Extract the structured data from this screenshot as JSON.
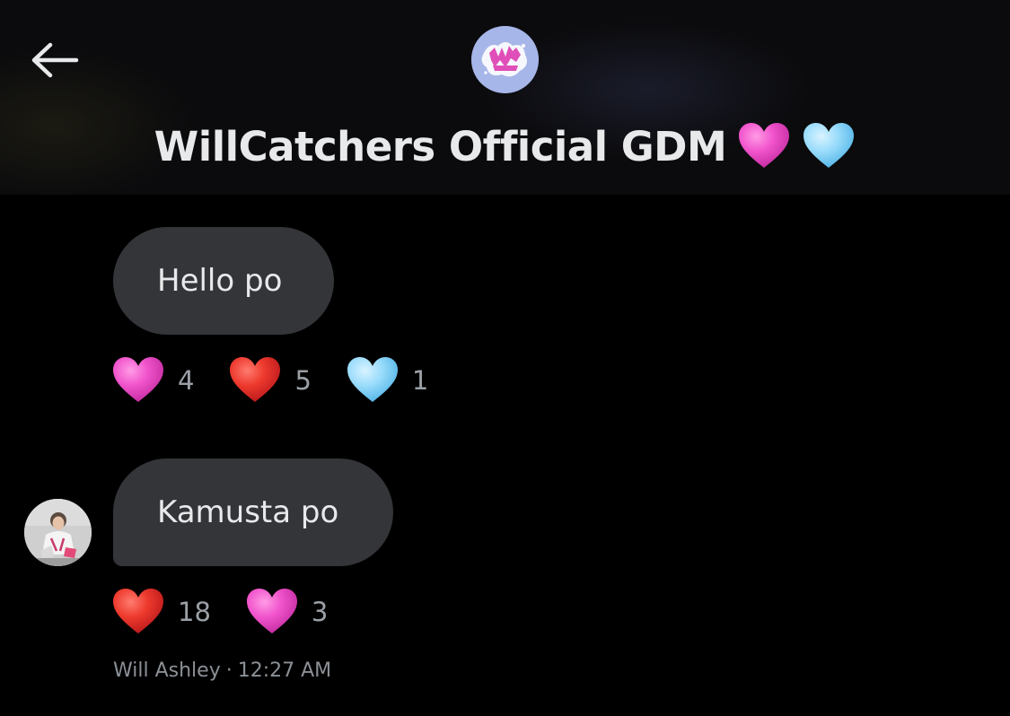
{
  "header": {
    "back_icon": "arrow-left-icon",
    "group_avatar_icon": "group-avatar-logo",
    "title": "WillCatchers Official GDM",
    "title_emojis": [
      "pink-heart-icon",
      "light-blue-heart-icon"
    ]
  },
  "messages": [
    {
      "text": "Hello po",
      "reactions": [
        {
          "icon": "pink-heart-icon",
          "count": "4"
        },
        {
          "icon": "red-heart-icon",
          "count": "5"
        },
        {
          "icon": "light-blue-heart-icon",
          "count": "1"
        }
      ]
    },
    {
      "text": "Kamusta po",
      "reactions": [
        {
          "icon": "red-heart-icon",
          "count": "18"
        },
        {
          "icon": "pink-heart-icon",
          "count": "3"
        }
      ],
      "sender": "Will Ashley",
      "separator": "·",
      "time": "12:27 AM"
    }
  ],
  "colors": {
    "background": "#000000",
    "bubble": "#333539",
    "text": "#e7e9ea",
    "muted": "#8b9096",
    "pink_heart": "#e64fc0",
    "red_heart": "#e3322b",
    "blue_heart": "#8fd3f4"
  }
}
